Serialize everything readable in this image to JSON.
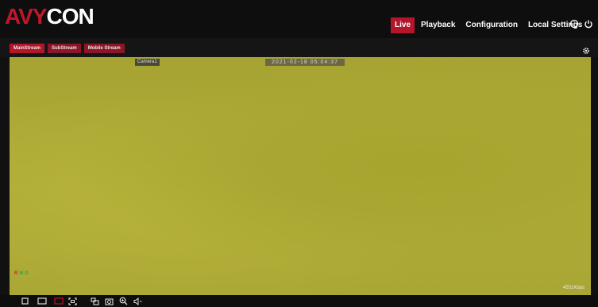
{
  "brand": {
    "part1": "AVY",
    "part2": "CON"
  },
  "nav": {
    "items": [
      {
        "label": "Live",
        "active": true
      },
      {
        "label": "Playback",
        "active": false
      },
      {
        "label": "Configuration",
        "active": false
      },
      {
        "label": "Local Settings",
        "active": false
      }
    ],
    "icons": [
      "info-icon",
      "power-icon"
    ]
  },
  "streams": {
    "tabs": [
      {
        "label": "MainStream",
        "active": true
      },
      {
        "label": "SubStream",
        "active": false
      },
      {
        "label": "Mobile Stream",
        "active": false
      }
    ],
    "settings_icon": "gear-icon"
  },
  "video": {
    "camera_name": "Camera1",
    "timestamp": "2021-02-18 05:04:37",
    "indicators": [
      "R",
      "M",
      "D"
    ],
    "bitrate": "4551Kbps"
  },
  "toolbar": {
    "tools": [
      "single-view-icon",
      "window-view-icon",
      "fullscreen-red-icon",
      "stretch-icon",
      "split-icon",
      "snapshot-icon",
      "zoom-icon",
      "audio-icon"
    ]
  },
  "colors": {
    "accent": "#b3152a",
    "background": "#0e0e0e",
    "video": "#aca935"
  }
}
